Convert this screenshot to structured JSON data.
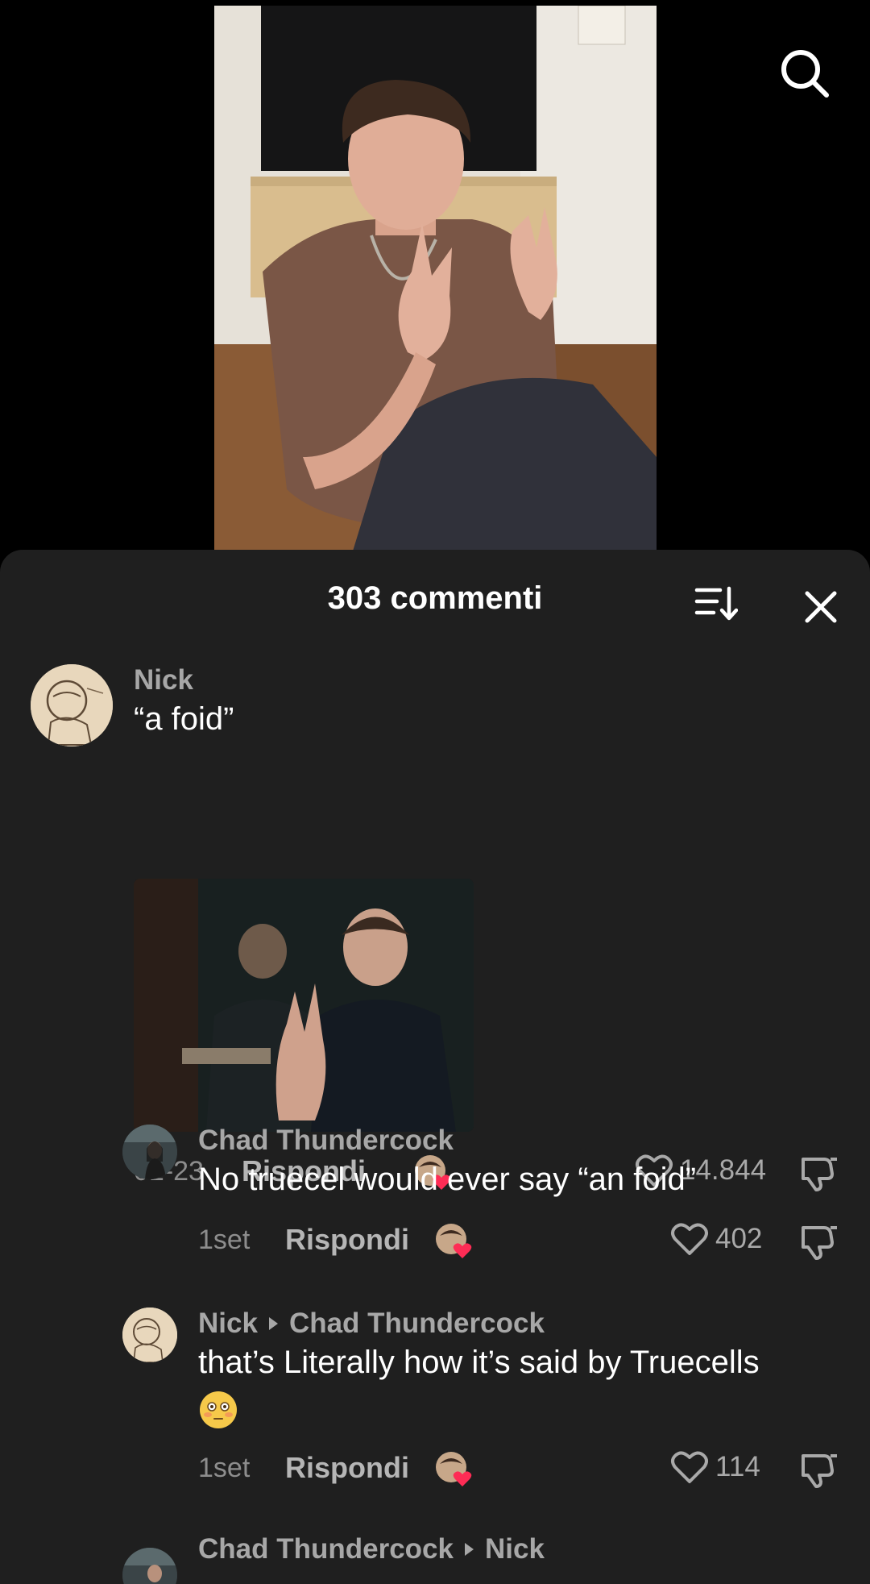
{
  "sheet": {
    "title": "303 commenti"
  },
  "comments": [
    {
      "author": "Nick",
      "text": "“a foid”",
      "date": "01-23",
      "reply_label": "Rispondi",
      "likes": "14.844",
      "has_gif": true
    },
    {
      "author": "Chad Thundercock",
      "text": "No truecel would ever say “an foid”",
      "date": "1set",
      "reply_label": "Rispondi",
      "likes": "402"
    },
    {
      "author": "Nick",
      "reply_to": "Chad Thundercock",
      "text": "that’s Literally how it’s said by Truecells",
      "emoji": "flushed-face",
      "date": "1set",
      "reply_label": "Rispondi",
      "likes": "114"
    },
    {
      "author": "Chad Thundercock",
      "reply_to": "Nick"
    }
  ],
  "colors": {
    "sheet_bg": "#1f1f1f",
    "like_heart": "#fe2c55"
  }
}
